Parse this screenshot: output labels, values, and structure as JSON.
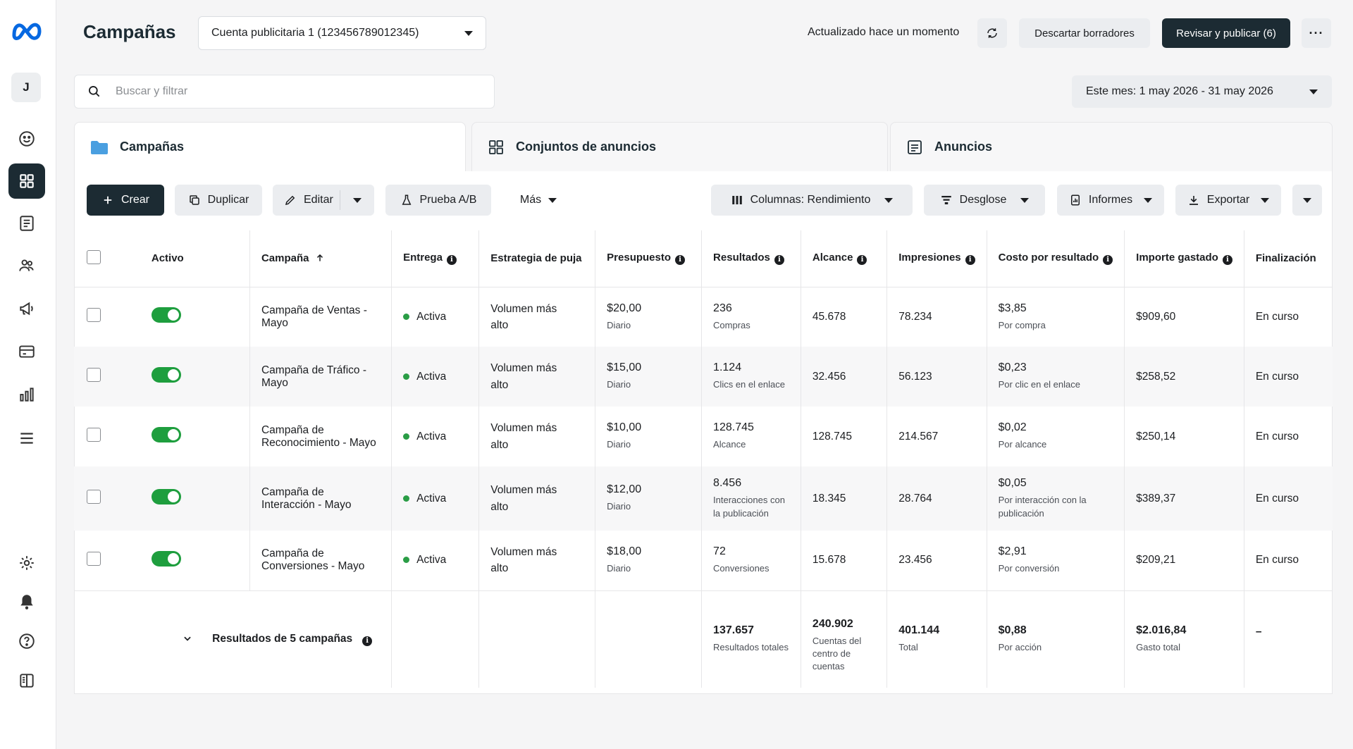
{
  "header": {
    "title": "Campañas",
    "account": "Cuenta publicitaria 1 (123456789012345)",
    "updated": "Actualizado hace un momento",
    "discard_label": "Descartar borradores",
    "publish_label": "Revisar y publicar (6)",
    "more_label": "···"
  },
  "sidebar": {
    "avatar": "J"
  },
  "search": {
    "placeholder": "Buscar y filtrar"
  },
  "date_range": "Este mes: 1 may 2026 - 31 may 2026",
  "tabs": [
    {
      "label": "Campañas"
    },
    {
      "label": "Conjuntos de anuncios"
    },
    {
      "label": "Anuncios"
    }
  ],
  "toolbar": {
    "create": "Crear",
    "duplicate": "Duplicar",
    "edit": "Editar",
    "ab_test": "Prueba A/B",
    "more": "Más",
    "columns": "Columnas: Rendimiento",
    "breakdown": "Desglose",
    "reports": "Informes",
    "export": "Exportar"
  },
  "columns": {
    "active": "Activo",
    "campaign": "Campaña",
    "delivery": "Entrega",
    "bid": "Estrategia de puja",
    "budget": "Presupuesto",
    "results": "Resultados",
    "reach": "Alcance",
    "impressions": "Impresiones",
    "cost": "Costo por resultado",
    "spent": "Importe gastado",
    "end": "Finalización"
  },
  "rows": [
    {
      "name": "Campaña de Ventas - Mayo",
      "delivery": "Activa",
      "bid": "Volumen más alto",
      "budget": "$20,00",
      "budget_type": "Diario",
      "results": "236",
      "results_type": "Compras",
      "reach": "45.678",
      "impressions": "78.234",
      "cost": "$3,85",
      "cost_type": "Por compra",
      "spent": "$909,60",
      "end": "En curso"
    },
    {
      "name": "Campaña de Tráfico - Mayo",
      "delivery": "Activa",
      "bid": "Volumen más alto",
      "budget": "$15,00",
      "budget_type": "Diario",
      "results": "1.124",
      "results_type": "Clics en el enlace",
      "reach": "32.456",
      "impressions": "56.123",
      "cost": "$0,23",
      "cost_type": "Por clic en el enlace",
      "spent": "$258,52",
      "end": "En curso"
    },
    {
      "name": "Campaña de Reconocimiento - Mayo",
      "delivery": "Activa",
      "bid": "Volumen más alto",
      "budget": "$10,00",
      "budget_type": "Diario",
      "results": "128.745",
      "results_type": "Alcance",
      "reach": "128.745",
      "impressions": "214.567",
      "cost": "$0,02",
      "cost_type": "Por alcance",
      "spent": "$250,14",
      "end": "En curso"
    },
    {
      "name": "Campaña de Interacción - Mayo",
      "delivery": "Activa",
      "bid": "Volumen más alto",
      "budget": "$12,00",
      "budget_type": "Diario",
      "results": "8.456",
      "results_type": "Interacciones con la publicación",
      "reach": "18.345",
      "impressions": "28.764",
      "cost": "$0,05",
      "cost_type": "Por interacción con la publicación",
      "spent": "$389,37",
      "end": "En curso"
    },
    {
      "name": "Campaña de Conversiones - Mayo",
      "delivery": "Activa",
      "bid": "Volumen más alto",
      "budget": "$18,00",
      "budget_type": "Diario",
      "results": "72",
      "results_type": "Conversiones",
      "reach": "15.678",
      "impressions": "23.456",
      "cost": "$2,91",
      "cost_type": "Por conversión",
      "spent": "$209,21",
      "end": "En curso"
    }
  ],
  "totals": {
    "label": "Resultados de 5 campañas",
    "results": "137.657",
    "results_sub": "Resultados totales",
    "reach": "240.902",
    "reach_sub": "Cuentas del centro de cuentas",
    "impressions": "401.144",
    "impressions_sub": "Total",
    "cost": "$0,88",
    "cost_sub": "Por acción",
    "spent": "$2.016,84",
    "spent_sub": "Gasto total",
    "end": "–"
  },
  "colors": {
    "brand_dark": "#1c2b33",
    "toggle_on": "#1e9e3e",
    "status_active": "#2a9d46",
    "meta_blue": "#0668e1"
  }
}
